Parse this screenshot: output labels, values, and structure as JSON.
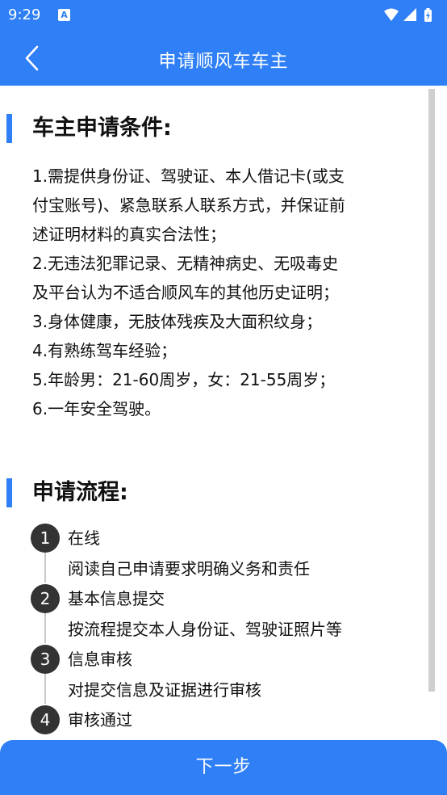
{
  "status_bar": {
    "time": "9:29",
    "notification_letter": "A"
  },
  "app_bar": {
    "title": "申请顺风车车主"
  },
  "conditions": {
    "heading": "车主申请条件:",
    "lines": [
      "1.需提供身份证、驾驶证、本人借记卡(或支",
      "付宝账号)、紧急联系人联系方式，并保证前",
      "述证明材料的真实合法性；",
      "2.无违法犯罪记录、无精神病史、无吸毒史",
      "及平台认为不适合顺风车的其他历史证明；",
      "3.身体健康，无肢体残疾及大面积纹身；",
      "4.有熟练驾车经验；",
      "5.年龄男：21-60周岁，女：21-55周岁；",
      "6.一年安全驾驶。"
    ]
  },
  "process": {
    "heading": "申请流程:",
    "steps": [
      {
        "number": "1",
        "title": "在线",
        "desc": "阅读自己申请要求明确义务和责任"
      },
      {
        "number": "2",
        "title": "基本信息提交",
        "desc": "按流程提交本人身份证、驾驶证照片等"
      },
      {
        "number": "3",
        "title": "信息审核",
        "desc": "对提交信息及证据进行审核"
      },
      {
        "number": "4",
        "title": "审核通过",
        "desc": ""
      }
    ]
  },
  "footer": {
    "next_label": "下一步"
  },
  "colors": {
    "primary": "#2f7ff6",
    "step_circle": "#333333"
  },
  "icons": [
    "back-arrow-icon",
    "wifi-icon",
    "signal-icon",
    "battery-icon"
  ]
}
